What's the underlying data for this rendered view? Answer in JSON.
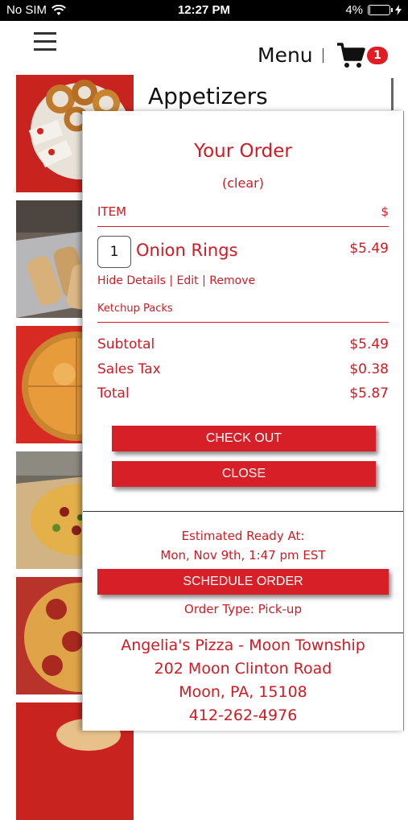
{
  "status_bar": {
    "carrier": "No SIM",
    "time": "12:27 PM",
    "battery": "4%",
    "battery_level": 0.04
  },
  "header": {
    "menu_label": "Menu",
    "cart_count": "1",
    "icons": [
      "hamburger-icon",
      "cart-icon",
      "wifi-icon",
      "battery-icon",
      "charging-icon"
    ]
  },
  "background": {
    "heading": "Appetizers"
  },
  "order": {
    "title": "Your Order",
    "clear_label": "(clear)",
    "col_item": "ITEM",
    "col_price": "$",
    "items": [
      {
        "qty": "1",
        "name": "Onion Rings",
        "price": "$5.49",
        "hide_details": "Hide Details",
        "edit": "Edit",
        "remove": "Remove",
        "sep": "|",
        "modifier": "Ketchup Packs"
      }
    ],
    "subtotal_label": "Subtotal",
    "subtotal": "$5.49",
    "tax_label": "Sales Tax",
    "tax": "$0.38",
    "total_label": "Total",
    "total": "$5.87",
    "checkout_label": "CHECK OUT",
    "close_label": "CLOSE",
    "eta_label": "Estimated Ready At:",
    "eta_time": "Mon, Nov 9th, 1:47 pm EST",
    "schedule_label": "SCHEDULE ORDER",
    "order_type": "Order Type: Pick-up"
  },
  "store": {
    "name": "Angelia's Pizza - Moon Township",
    "street": "202 Moon Clinton Road",
    "city": "Moon, PA, 15108",
    "phone": "412-262-4976"
  },
  "colors": {
    "accent": "#d11a22",
    "button": "#d61f26",
    "badge": "#e31b23"
  }
}
